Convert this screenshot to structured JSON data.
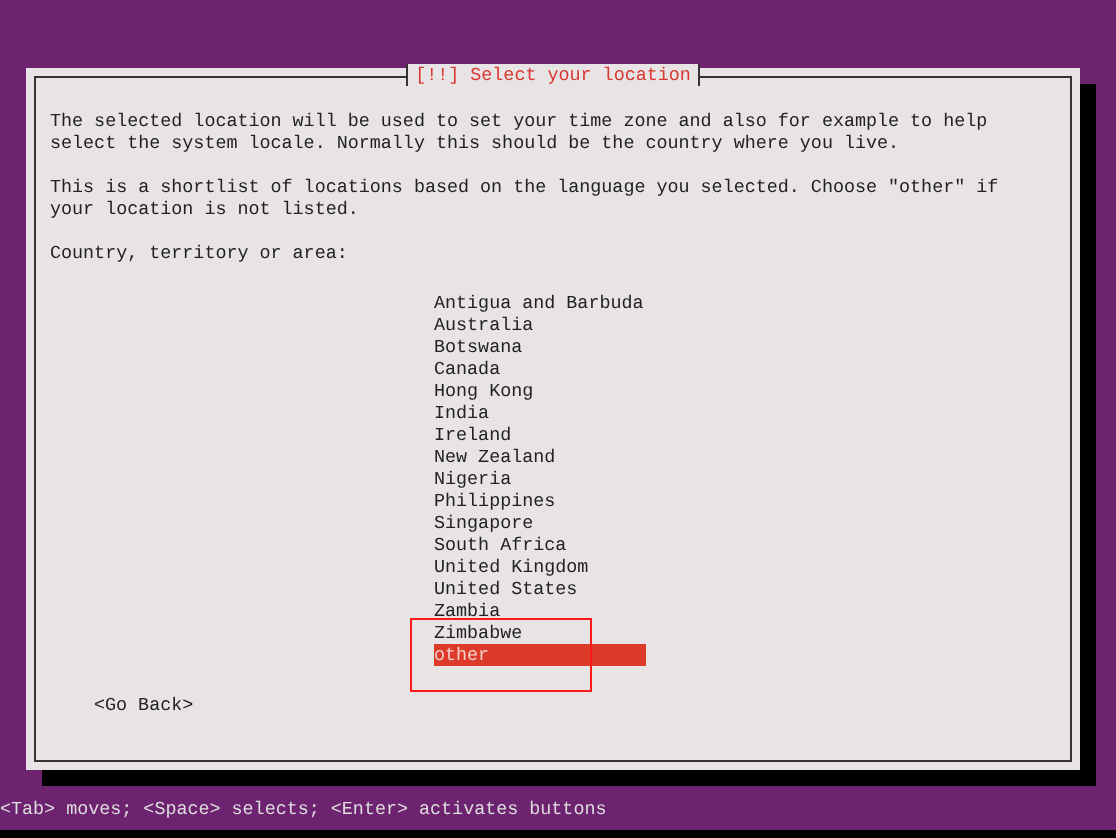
{
  "dialog": {
    "title": "[!!] Select your location",
    "paragraphs": [
      "The selected location will be used to set your time zone and also for example to help\nselect the system locale. Normally this should be the country where you live.",
      "This is a shortlist of locations based on the language you selected. Choose \"other\" if\nyour location is not listed."
    ],
    "prompt": "Country, territory or area:",
    "options": [
      {
        "label": "Antigua and Barbuda",
        "selected": false
      },
      {
        "label": "Australia",
        "selected": false
      },
      {
        "label": "Botswana",
        "selected": false
      },
      {
        "label": "Canada",
        "selected": false
      },
      {
        "label": "Hong Kong",
        "selected": false
      },
      {
        "label": "India",
        "selected": false
      },
      {
        "label": "Ireland",
        "selected": false
      },
      {
        "label": "New Zealand",
        "selected": false
      },
      {
        "label": "Nigeria",
        "selected": false
      },
      {
        "label": "Philippines",
        "selected": false
      },
      {
        "label": "Singapore",
        "selected": false
      },
      {
        "label": "South Africa",
        "selected": false
      },
      {
        "label": "United Kingdom",
        "selected": false
      },
      {
        "label": "United States",
        "selected": false
      },
      {
        "label": "Zambia",
        "selected": false
      },
      {
        "label": "Zimbabwe",
        "selected": false
      },
      {
        "label": "other",
        "selected": true
      }
    ],
    "back_button": "<Go Back>"
  },
  "annotation": {
    "kind": "rectangle"
  },
  "status_bar": "<Tab> moves; <Space> selects; <Enter> activates buttons"
}
